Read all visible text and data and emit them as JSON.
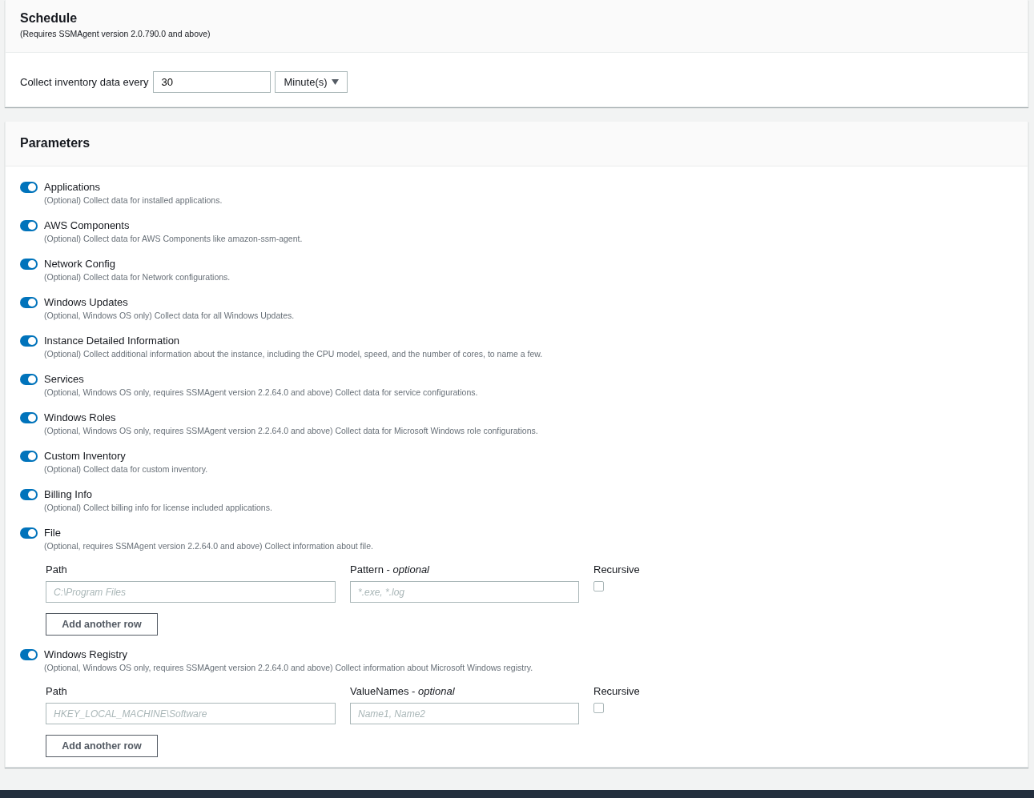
{
  "schedule": {
    "title": "Schedule",
    "subtitle": "(Requires SSMAgent version 2.0.790.0 and above)",
    "interval_label": "Collect inventory data every",
    "interval_value": "30",
    "unit": "Minute(s)"
  },
  "parameters": {
    "title": "Parameters",
    "items": [
      {
        "label": "Applications",
        "description": "(Optional) Collect data for installed applications.",
        "on": true
      },
      {
        "label": "AWS Components",
        "description": "(Optional) Collect data for AWS Components like amazon-ssm-agent.",
        "on": true
      },
      {
        "label": "Network Config",
        "description": "(Optional) Collect data for Network configurations.",
        "on": true
      },
      {
        "label": "Windows Updates",
        "description": "(Optional, Windows OS only) Collect data for all Windows Updates.",
        "on": true
      },
      {
        "label": "Instance Detailed Information",
        "description": "(Optional) Collect additional information about the instance, including the CPU model, speed, and the number of cores, to name a few.",
        "on": true
      },
      {
        "label": "Services",
        "description": "(Optional, Windows OS only, requires SSMAgent version 2.2.64.0 and above) Collect data for service configurations.",
        "on": true
      },
      {
        "label": "Windows Roles",
        "description": "(Optional, Windows OS only, requires SSMAgent version 2.2.64.0 and above) Collect data for Microsoft Windows role configurations.",
        "on": true
      },
      {
        "label": "Custom Inventory",
        "description": "(Optional) Collect data for custom inventory.",
        "on": true
      },
      {
        "label": "Billing Info",
        "description": "(Optional) Collect billing info for license included applications.",
        "on": true
      },
      {
        "label": "File",
        "description": "(Optional, requires SSMAgent version 2.2.64.0 and above) Collect information about file.",
        "on": true,
        "fields": [
          {
            "label": "Path",
            "placeholder": "C:\\Program Files"
          },
          {
            "label": "Pattern - *optional*",
            "placeholder": "*.exe, *.log"
          }
        ],
        "recursive": {
          "label": "Recursive",
          "checked": false
        },
        "button": "Add another row"
      },
      {
        "label": "Windows Registry",
        "description": "(Optional, Windows OS only, requires SSMAgent version 2.2.64.0 and above) Collect information about Microsoft Windows registry.",
        "on": true,
        "fields": [
          {
            "label": "Path",
            "placeholder": "HKEY_LOCAL_MACHINE\\Software"
          },
          {
            "label": "ValueNames - *optional*",
            "placeholder": "Name1, Name2"
          }
        ],
        "recursive": {
          "label": "Recursive",
          "checked": false
        },
        "button": "Add another row"
      }
    ]
  }
}
